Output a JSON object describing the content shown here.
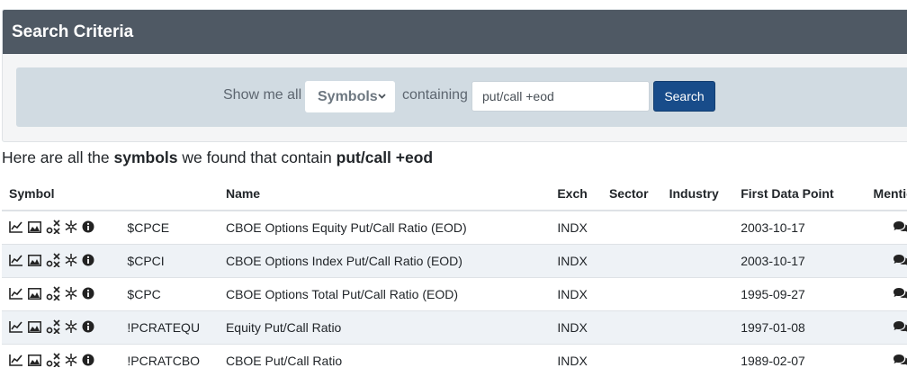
{
  "panel": {
    "title": "Search Criteria"
  },
  "search": {
    "show_me_all": "Show me all",
    "select_value": "Symbols",
    "containing": "containing",
    "query": "put/call +eod",
    "button": "Search"
  },
  "results": {
    "prefix": "Here are all the",
    "bold_type": "symbols",
    "middle": "we found that contain",
    "bold_query": "put/call +eod"
  },
  "table": {
    "headers": {
      "symbol": "Symbol",
      "name": "Name",
      "exch": "Exch",
      "sector": "Sector",
      "industry": "Industry",
      "first_data_point": "First Data Point",
      "mentions": "Mentions"
    },
    "rows": [
      {
        "symbol": "$CPCE",
        "name": "CBOE Options Equity Put/Call Ratio (EOD)",
        "exch": "INDX",
        "sector": "",
        "industry": "",
        "first": "2003-10-17"
      },
      {
        "symbol": "$CPCI",
        "name": "CBOE Options Index Put/Call Ratio (EOD)",
        "exch": "INDX",
        "sector": "",
        "industry": "",
        "first": "2003-10-17"
      },
      {
        "symbol": "$CPC",
        "name": "CBOE Options Total Put/Call Ratio (EOD)",
        "exch": "INDX",
        "sector": "",
        "industry": "",
        "first": "1995-09-27"
      },
      {
        "symbol": "!PCRATEQU",
        "name": "Equity Put/Call Ratio",
        "exch": "INDX",
        "sector": "",
        "industry": "",
        "first": "1997-01-08"
      },
      {
        "symbol": "!PCRATCBO",
        "name": "CBOE Put/Call Ratio",
        "exch": "INDX",
        "sector": "",
        "industry": "",
        "first": "1989-02-07"
      }
    ],
    "row_icons": [
      "line-chart-icon",
      "area-chart-icon",
      "pnf-chart-icon",
      "seasonality-icon",
      "info-icon",
      "mentions-icon"
    ]
  },
  "colors": {
    "header_bg": "#4f5964",
    "search_bg": "#d1dbe2",
    "button_bg": "#184c8a",
    "row_stripe": "#eef2f6"
  }
}
